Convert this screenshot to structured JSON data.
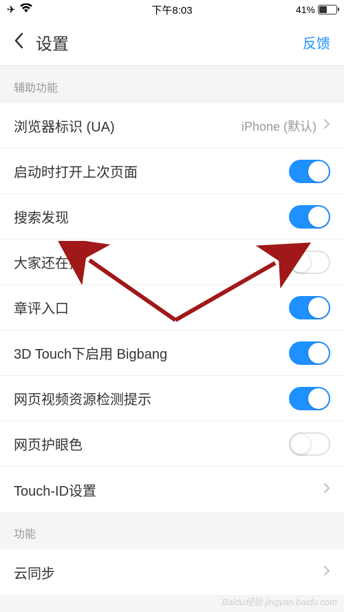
{
  "status_bar": {
    "time": "下午8:03",
    "battery_percent": "41%",
    "battery_level": 41
  },
  "nav": {
    "title": "设置",
    "feedback": "反馈"
  },
  "sections": [
    {
      "header": "辅助功能",
      "rows": [
        {
          "label": "浏览器标识 (UA)",
          "value": "iPhone (默认)",
          "type": "detail"
        },
        {
          "label": "启动时打开上次页面",
          "type": "toggle",
          "on": true
        },
        {
          "label": "搜索发现",
          "type": "toggle",
          "on": true
        },
        {
          "label": "大家还在搜",
          "type": "toggle",
          "on": false
        },
        {
          "label": "章评入口",
          "type": "toggle",
          "on": true
        },
        {
          "label": "3D Touch下启用 Bigbang",
          "type": "toggle",
          "on": true
        },
        {
          "label": "网页视频资源检测提示",
          "type": "toggle",
          "on": true
        },
        {
          "label": "网页护眼色",
          "type": "toggle",
          "on": false
        },
        {
          "label": "Touch-ID设置",
          "type": "detail"
        }
      ]
    },
    {
      "header": "功能",
      "rows": [
        {
          "label": "云同步",
          "type": "detail"
        }
      ]
    }
  ],
  "watermark": "Baidu经验 jingyan.baidu.com"
}
